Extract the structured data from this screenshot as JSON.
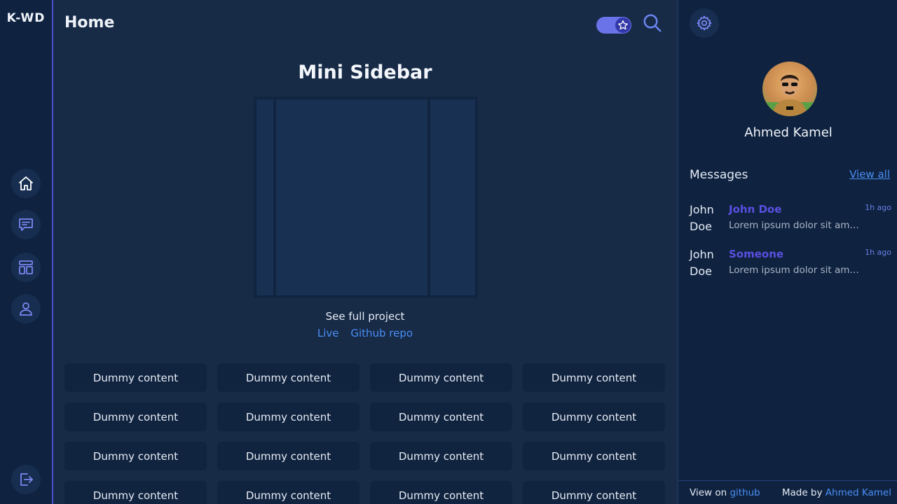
{
  "logo": "K-WD",
  "header": {
    "title": "Home"
  },
  "icons": {
    "home": "home-icon",
    "messages": "chat-icon",
    "layout": "layout-icon",
    "profile": "user-icon",
    "logout": "logout-icon",
    "search": "search-icon",
    "settings": "gear-icon",
    "theme": "star-icon"
  },
  "hero": {
    "title": "Mini Sidebar",
    "see_full": "See full project",
    "live_link": "Live",
    "github_link": "Github repo"
  },
  "cards": [
    "Dummy content",
    "Dummy content",
    "Dummy content",
    "Dummy content",
    "Dummy content",
    "Dummy content",
    "Dummy content",
    "Dummy content",
    "Dummy content",
    "Dummy content",
    "Dummy content",
    "Dummy content",
    "Dummy content",
    "Dummy content",
    "Dummy content",
    "Dummy content"
  ],
  "profile": {
    "name": "Ahmed Kamel"
  },
  "messages": {
    "header": "Messages",
    "view_all": "View all",
    "items": [
      {
        "avatar_text": "John Doe",
        "sender": "John Doe",
        "time": "1h ago",
        "preview": "Lorem ipsum dolor sit amet consectetur adipisicing elit."
      },
      {
        "avatar_text": "John Doe",
        "sender": "Someone",
        "time": "1h ago",
        "preview": "Lorem ipsum dolor sit amet consectetur adipisicing elit."
      }
    ]
  },
  "footer": {
    "view_on": "View on",
    "github": "github",
    "made_by": "Made by",
    "author": "Ahmed Kamel"
  },
  "colors": {
    "accent": "#4a8ef5",
    "brand": "#4b4fd0",
    "sender": "#5b4fe0",
    "background": "#172a46",
    "sidebar": "#0f2340"
  }
}
